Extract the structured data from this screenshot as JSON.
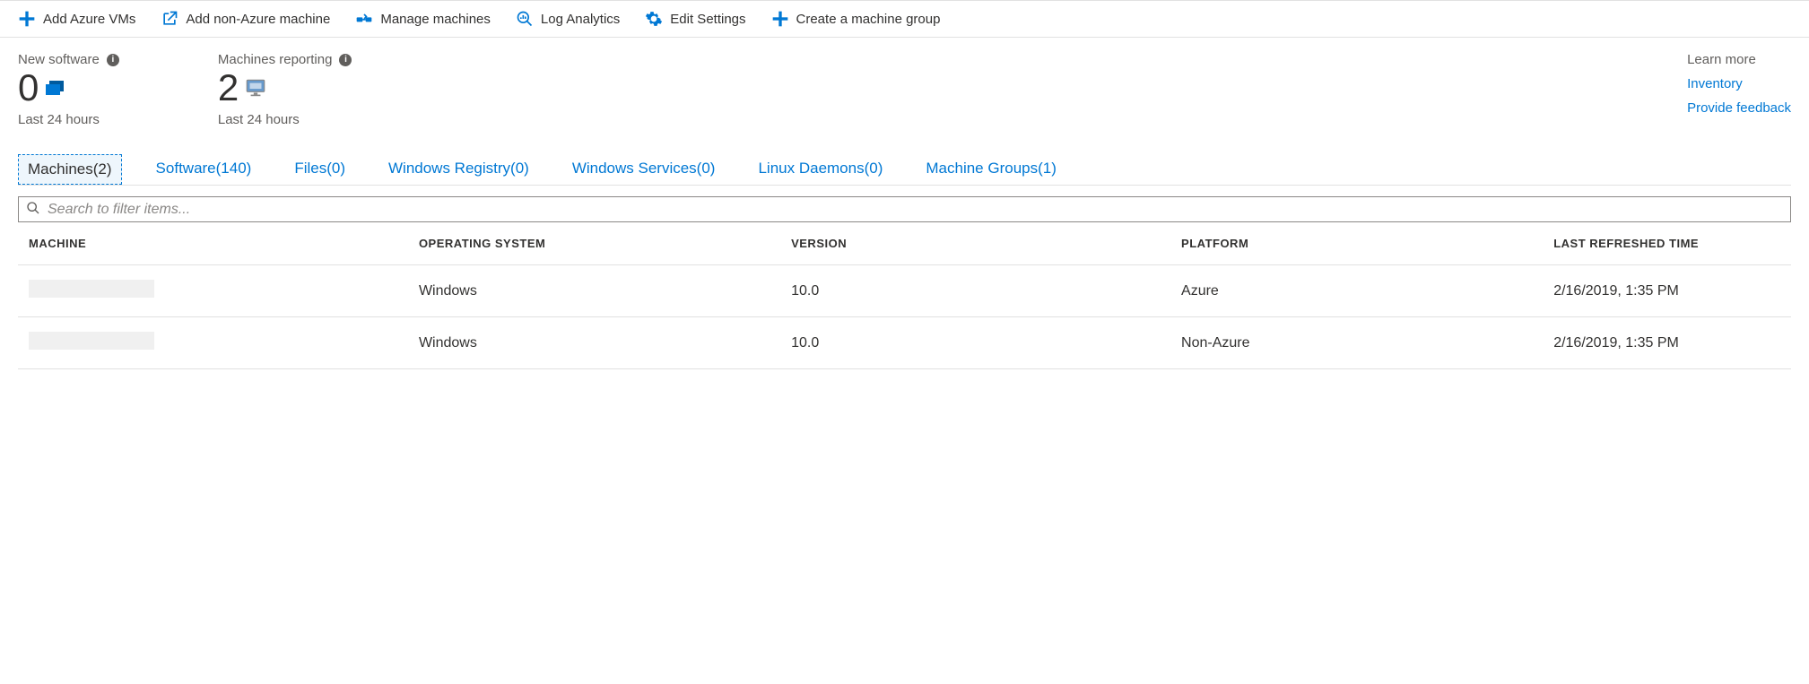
{
  "toolbar": {
    "add_vms": "Add Azure VMs",
    "add_nonazure": "Add non-Azure machine",
    "manage": "Manage machines",
    "log_analytics": "Log Analytics",
    "edit_settings": "Edit Settings",
    "create_group": "Create a machine group"
  },
  "summary": {
    "new_software": {
      "title": "New software",
      "value": "0",
      "sub": "Last 24 hours"
    },
    "machines_reporting": {
      "title": "Machines reporting",
      "value": "2",
      "sub": "Last 24 hours"
    }
  },
  "learn_more": {
    "title": "Learn more",
    "inventory": "Inventory",
    "feedback": "Provide feedback"
  },
  "tabs": {
    "machines": "Machines(2)",
    "software": "Software(140)",
    "files": "Files(0)",
    "registry": "Windows Registry(0)",
    "services": "Windows Services(0)",
    "daemons": "Linux Daemons(0)",
    "groups": "Machine Groups(1)"
  },
  "search": {
    "placeholder": "Search to filter items..."
  },
  "table": {
    "headers": {
      "machine": "MACHINE",
      "os": "OPERATING SYSTEM",
      "version": "VERSION",
      "platform": "PLATFORM",
      "refreshed": "LAST REFRESHED TIME"
    },
    "rows": [
      {
        "machine": "",
        "os": "Windows",
        "version": "10.0",
        "platform": "Azure",
        "refreshed": "2/16/2019, 1:35 PM"
      },
      {
        "machine": "",
        "os": "Windows",
        "version": "10.0",
        "platform": "Non-Azure",
        "refreshed": "2/16/2019, 1:35 PM"
      }
    ]
  }
}
